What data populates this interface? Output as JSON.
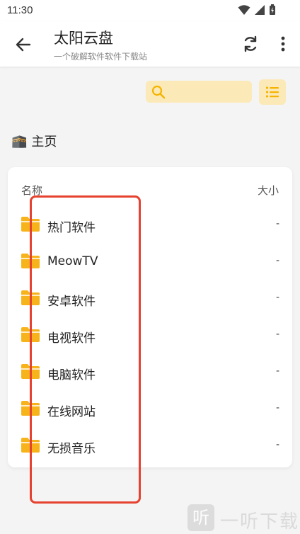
{
  "status_bar": {
    "time": "11:30"
  },
  "app_bar": {
    "title": "太阳云盘",
    "subtitle": "一个破解软件软件下载站"
  },
  "search": {
    "placeholder": "",
    "value": ""
  },
  "breadcrumb": {
    "home_emoji": "🕋",
    "home_label": "主页"
  },
  "table": {
    "header_name": "名称",
    "header_size": "大小",
    "rows": [
      {
        "name": "热门软件",
        "size": "-"
      },
      {
        "name": "MeowTV",
        "size": "-"
      },
      {
        "name": "安卓软件",
        "size": "-"
      },
      {
        "name": "电视软件",
        "size": "-"
      },
      {
        "name": "电脑软件",
        "size": "-"
      },
      {
        "name": "在线网站",
        "size": "-"
      },
      {
        "name": "无损音乐",
        "size": "-"
      }
    ]
  },
  "watermark": {
    "box_char": "听",
    "text": "一听下载"
  },
  "colors": {
    "accent_light": "#fbe9b8",
    "accent": "#f5b400",
    "folder": "#f7b31b",
    "annotation": "#e5422f"
  }
}
